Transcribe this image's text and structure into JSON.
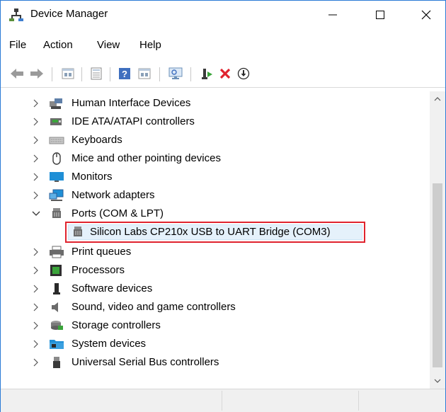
{
  "window": {
    "title": "Device Manager"
  },
  "menu": {
    "items": [
      "File",
      "Action",
      "View",
      "Help"
    ]
  },
  "toolbar": {
    "icons": [
      "back-arrow-icon",
      "forward-arrow-icon",
      "show-hidden-icon",
      "properties-icon",
      "help-icon",
      "view-icon",
      "scan-hardware-icon",
      "update-driver-icon",
      "uninstall-icon",
      "disable-device-icon"
    ]
  },
  "tree": {
    "items": [
      {
        "label": "Human Interface Devices",
        "expanded": false,
        "icon": "hid-icon"
      },
      {
        "label": "IDE ATA/ATAPI controllers",
        "expanded": false,
        "icon": "ide-icon"
      },
      {
        "label": "Keyboards",
        "expanded": false,
        "icon": "keyboard-icon"
      },
      {
        "label": "Mice and other pointing devices",
        "expanded": false,
        "icon": "mouse-icon"
      },
      {
        "label": "Monitors",
        "expanded": false,
        "icon": "monitor-icon"
      },
      {
        "label": "Network adapters",
        "expanded": false,
        "icon": "network-icon"
      },
      {
        "label": "Ports (COM & LPT)",
        "expanded": true,
        "icon": "port-icon"
      },
      {
        "label": "Silicon Labs CP210x USB to UART Bridge (COM3)",
        "child": true,
        "selected": true,
        "icon": "port-icon"
      },
      {
        "label": "Print queues",
        "expanded": false,
        "icon": "printer-icon"
      },
      {
        "label": "Processors",
        "expanded": false,
        "icon": "processor-icon"
      },
      {
        "label": "Software devices",
        "expanded": false,
        "icon": "software-device-icon"
      },
      {
        "label": "Sound, video and game controllers",
        "expanded": false,
        "icon": "speaker-icon"
      },
      {
        "label": "Storage controllers",
        "expanded": false,
        "icon": "storage-icon"
      },
      {
        "label": "System devices",
        "expanded": false,
        "icon": "system-folder-icon"
      },
      {
        "label": "Universal Serial Bus controllers",
        "expanded": false,
        "icon": "usb-icon"
      }
    ]
  },
  "colors": {
    "selection_border": "#e0232e",
    "selection_fill": "#e5f1fb",
    "accent": "#2b7bd6"
  }
}
